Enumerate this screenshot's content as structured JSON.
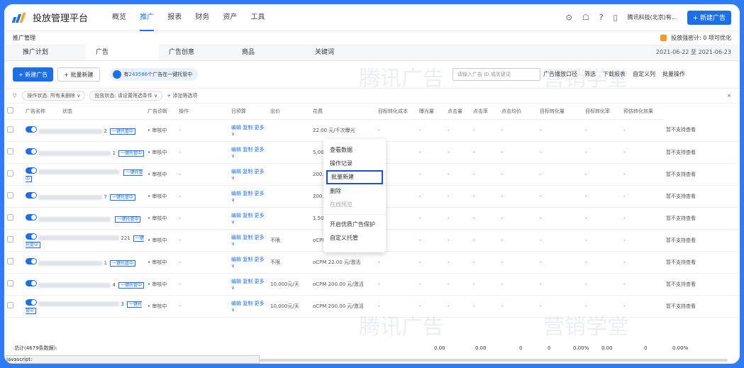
{
  "app": {
    "title": "投放管理平台",
    "nav": [
      "概览",
      "推广",
      "报表",
      "财务",
      "资产",
      "工具"
    ],
    "account": "腾讯科技(北京)有...",
    "new_ad": "+ 新建广告"
  },
  "crumb": {
    "text": "推广管理",
    "hint": "投放强密计: 0 项可优化"
  },
  "tabs": [
    "推广计划",
    "广告",
    "广告创意",
    "商品",
    "关键词"
  ],
  "date_range": "2021-06-22 至 2021-06-23",
  "actions": {
    "new_ad": "+ 新建广告",
    "bulk": "+ 批量新建",
    "badge_pre": "有",
    "badge_num": "243586",
    "badge_post": "个广告在一键托管中",
    "search_placeholder": "请输入广告 ID 或关键词",
    "tools": [
      "广告播放口径",
      "筛选",
      "下载报表",
      "自定义列",
      "批量操作"
    ]
  },
  "filters": {
    "f1": "操作状态: 所有未删除 ∨",
    "f2": "投放状态: 请设置筛选条件 ∨",
    "add": "+ 添加筛选项"
  },
  "columns": [
    "广告名称",
    "状态",
    "广告诊断",
    "操作",
    "日预算",
    "出价",
    "花费",
    "目标转化成本",
    "曝光量",
    "点击量",
    "点击率",
    "点击均价",
    "目标转化量",
    "目标转化率",
    "预估转化效果"
  ],
  "rows": [
    {
      "suffix": "2",
      "tag": "一键托管中",
      "status": "• 审核中",
      "diag": "-",
      "ops": "编辑  复制  更多 ∨",
      "budget": "",
      "bid": "22.00 元/千次曝光",
      "effect": "暂不支持查看"
    },
    {
      "suffix": "1",
      "tag": "一键托管中",
      "status": "• 审核中",
      "diag": "-",
      "ops": "编辑  复制  更多 ∨",
      "budget": "",
      "bid": "5.00 元/千次曝光",
      "effect": "暂不支持查看"
    },
    {
      "suffix": "",
      "tag": "一键托管中",
      "status": "• 审核中",
      "diag": "-",
      "ops": "编辑  复制  更多 ∨",
      "budget": "",
      "bid": "200.00 元/激活",
      "effect": "暂不支持查看"
    },
    {
      "suffix": "7",
      "tag": "一键托管中",
      "status": "• 审核中",
      "diag": "-",
      "ops": "编辑  复制  更多 ∨",
      "budget": "",
      "bid": "200.00 元/激活",
      "effect": "暂不支持查看"
    },
    {
      "suffix": "",
      "tag": "一键托管中",
      "status": "• 审核中",
      "diag": "-",
      "ops": "编辑  复制  更多 ∨",
      "budget": "",
      "bid": "1.50 元/下单",
      "effect": "暂不支持查看"
    },
    {
      "suffix": "221",
      "tag": "一键托管中",
      "status": "• 审核中",
      "diag": "-",
      "ops": "编辑  复制  更多 ∨",
      "budget": "不限",
      "bid": "oCPM 22.00 元/激活",
      "effect": "暂不支持查看"
    },
    {
      "suffix": "1",
      "tag": "一键托管中",
      "status": "• 审核中",
      "diag": "-",
      "ops": "编辑  复制  更多 ∨",
      "budget": "不限",
      "bid": "oCPM 22.00 元/激活",
      "effect": "暂不支持查看"
    },
    {
      "suffix": "4",
      "tag": "一键托管中",
      "status": "• 审核中",
      "diag": "-",
      "ops": "编辑  复制  更多 ∨",
      "budget": "10,000元/天",
      "bid": "oCPM 200.00 元/激活",
      "effect": "暂不支持查看"
    },
    {
      "suffix": "3",
      "tag": "一键托管中",
      "status": "• 审核中",
      "diag": "-",
      "ops": "编辑  复制  更多 ∨",
      "budget": "10,000元/天",
      "bid": "oCPM 200.00 元/激活",
      "effect": "暂不支持查看"
    }
  ],
  "menu": [
    "查看数据",
    "操作记录",
    "批量新建",
    "删除",
    "在线预览",
    "开启优质广告保护",
    "自定义托管"
  ],
  "footer": {
    "label": "总计(4679条数据):",
    "vals": [
      "0.00",
      "0.00",
      "0",
      "0",
      "0.00%",
      "0.00",
      "0",
      "0.00%"
    ]
  },
  "status_bar": "javascript:",
  "watermark": {
    "w1": "营销学堂",
    "w2": "腾讯广告"
  }
}
